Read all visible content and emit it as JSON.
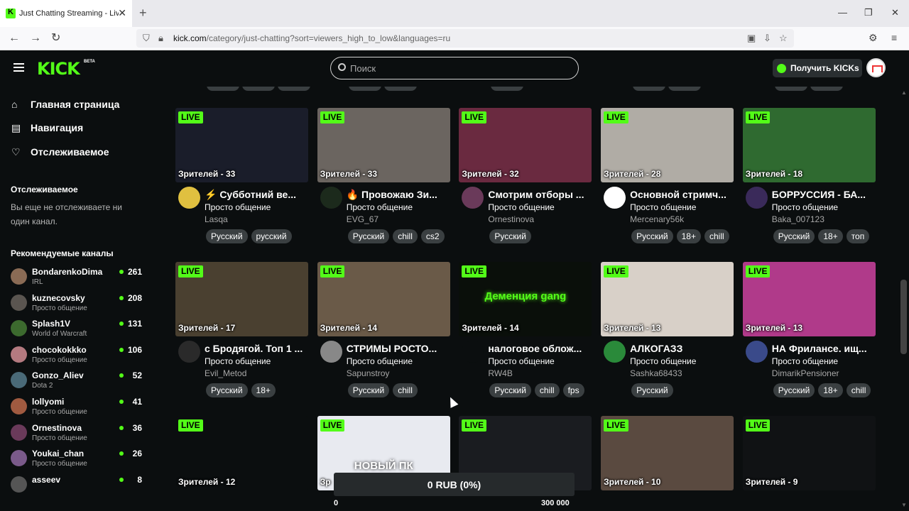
{
  "browser": {
    "tab_title": "Just Chatting Streaming - Live S",
    "url_host": "kick.com",
    "url_rest": "/category/just-chatting?sort=viewers_high_to_low&languages=ru"
  },
  "header": {
    "logo": "KICK",
    "logo_badge": "BETA",
    "search_placeholder": "Поиск",
    "kicks_button": "Получить KICKs"
  },
  "sidebar": {
    "nav": [
      {
        "label": "Главная страница",
        "icon": "home-icon"
      },
      {
        "label": "Навигация",
        "icon": "browse-icon"
      },
      {
        "label": "Отслеживаемое",
        "icon": "heart-icon"
      }
    ],
    "following_heading": "Отслеживаемое",
    "following_empty": "Вы еще не отслеживаете ни один канал.",
    "recommended_heading": "Рекомендуемые каналы",
    "recommended": [
      {
        "name": "BondarenkoDima",
        "category": "IRL",
        "viewers": "261",
        "color": "#8a6b55"
      },
      {
        "name": "kuznecovsky",
        "category": "Просто общение",
        "viewers": "208",
        "color": "#5a5550"
      },
      {
        "name": "Splash1V",
        "category": "World of Warcraft",
        "viewers": "131",
        "color": "#3c6a2e"
      },
      {
        "name": "chocokokkko",
        "category": "Просто общение",
        "viewers": "106",
        "color": "#b47a80"
      },
      {
        "name": "Gonzo_Aliev",
        "category": "Dota 2",
        "viewers": "52",
        "color": "#4a6a78"
      },
      {
        "name": "lollyomi",
        "category": "Просто общение",
        "viewers": "41",
        "color": "#a05a40"
      },
      {
        "name": "Ornestinova",
        "category": "Просто общение",
        "viewers": "36",
        "color": "#6a3a5a"
      },
      {
        "name": "Youkai_chan",
        "category": "Просто общение",
        "viewers": "26",
        "color": "#7a5a8a"
      },
      {
        "name": "asseev",
        "category": "",
        "viewers": "8",
        "color": "#555555"
      }
    ]
  },
  "cards_row1": [
    {
      "live": "LIVE",
      "viewers": "Зрителей - 33",
      "title": "⚡ Субботний ве...",
      "category": "Просто общение",
      "user": "Lasqa",
      "tags": [
        "Русский",
        "русский"
      ],
      "thumb": "#1a1d2a",
      "avatar": "#e0c040"
    },
    {
      "live": "LIVE",
      "viewers": "Зрителей - 33",
      "title": "🔥 Провожаю Зи...",
      "category": "Просто общение",
      "user": "EVG_67",
      "tags": [
        "Русский",
        "chill",
        "cs2"
      ],
      "thumb": "#6b6560",
      "avatar": "#1c2a1c"
    },
    {
      "live": "LIVE",
      "viewers": "Зрителей - 32",
      "title": "Смотрим отборы ...",
      "category": "Просто общение",
      "user": "Ornestinova",
      "tags": [
        "Русский"
      ],
      "thumb": "#6a2a40",
      "avatar": "#6a3a5a"
    },
    {
      "live": "LIVE",
      "viewers": "Зрителей - 28",
      "title": "Основной стримч...",
      "category": "Просто общение",
      "user": "Mercenary56k",
      "tags": [
        "Русский",
        "18+",
        "chill"
      ],
      "thumb": "#b0aca5",
      "avatar": "#ffffff"
    },
    {
      "live": "LIVE",
      "viewers": "Зрителей - 18",
      "title": "БОРРУССИЯ - БА...",
      "category": "Просто общение",
      "user": "Baka_007123",
      "tags": [
        "Русский",
        "18+",
        "топ"
      ],
      "thumb": "#2f6a30",
      "avatar": "#3a2a5a"
    }
  ],
  "cards_row2": [
    {
      "live": "LIVE",
      "viewers": "Зрителей - 17",
      "title": "с Бродягой. Топ 1 ...",
      "category": "Просто общение",
      "user": "Evil_Metod",
      "tags": [
        "Русский",
        "18+"
      ],
      "thumb": "#4a4030",
      "avatar": "#2a2a2a"
    },
    {
      "live": "LIVE",
      "viewers": "Зрителей - 14",
      "title": "СТРИМЫ РОСТО...",
      "category": "Просто общение",
      "user": "Sapunstroy",
      "tags": [
        "Русский",
        "chill"
      ],
      "thumb": "#6a5a48",
      "avatar": "#888888"
    },
    {
      "live": "LIVE",
      "viewers": "Зрителей - 14",
      "title": "налоговое облож...",
      "category": "Просто общение",
      "user": "RW4B",
      "tags": [
        "Русский",
        "chill",
        "fps"
      ],
      "thumb": "#0a0f0a",
      "avatar": "#0b0e0f",
      "overlay": "Деменция gang"
    },
    {
      "live": "LIVE",
      "viewers": "Зрителей - 13",
      "title": "АЛКОГАЗЗ",
      "category": "Просто общение",
      "user": "Sashka68433",
      "tags": [
        "Русский"
      ],
      "thumb": "#d8d0c8",
      "avatar": "#2a8a3a"
    },
    {
      "live": "LIVE",
      "viewers": "Зрителей - 13",
      "title": "НА Фрилансе. ищ...",
      "category": "Просто общение",
      "user": "DimarikPensioner",
      "tags": [
        "Русский",
        "18+",
        "chill"
      ],
      "thumb": "#b03a8a",
      "avatar": "#3a4a8a"
    }
  ],
  "cards_row3": [
    {
      "live": "LIVE",
      "viewers": "Зрителей - 12",
      "thumb": "#0b0e0f"
    },
    {
      "live": "LIVE",
      "viewers": "Зр",
      "thumb": "#e8eaf0",
      "overlay": "НОВЫЙ ПК"
    },
    {
      "live": "LIVE",
      "viewers": "",
      "thumb": "#1a1c20"
    },
    {
      "live": "LIVE",
      "viewers": "Зрителей - 10",
      "thumb": "#5a4a40"
    },
    {
      "live": "LIVE",
      "viewers": "Зрителей - 9",
      "thumb": "#101214"
    }
  ],
  "donation": {
    "label": "0 RUB (0%)",
    "progress_fraction": 0,
    "min": "0",
    "max": "300 000"
  }
}
